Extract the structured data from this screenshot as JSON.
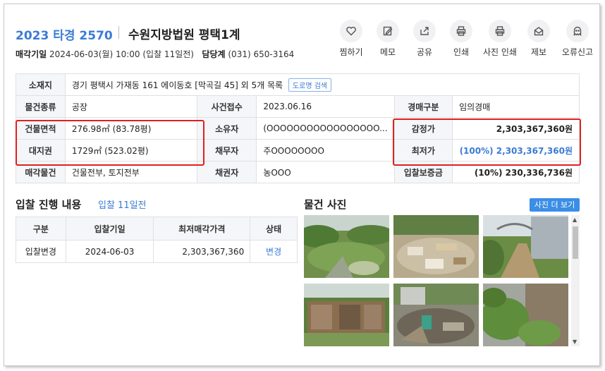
{
  "header": {
    "case_number": "2023 타경 2570",
    "court": "수원지방법원 평택1계",
    "sale_date_label": "매각기일",
    "sale_date_value": "2024-06-03(월) 10:00 (입찰 11일전)",
    "dept_label": "담당계",
    "dept_phone": "(031) 650-3164"
  },
  "actions": [
    {
      "label": "찜하기",
      "icon": "heart-icon"
    },
    {
      "label": "메모",
      "icon": "memo-icon"
    },
    {
      "label": "공유",
      "icon": "share-icon"
    },
    {
      "label": "인쇄",
      "icon": "print-icon"
    },
    {
      "label": "사진 인쇄",
      "icon": "print-icon"
    },
    {
      "label": "제보",
      "icon": "mail-icon"
    },
    {
      "label": "오류신고",
      "icon": "ghost-icon"
    }
  ],
  "details": {
    "location_label": "소재지",
    "location_value": "경기 평택시 가재동 161 에이동호 [막곡길 45] 외 5개 목록",
    "road_search": "도로명 검색",
    "type_label": "물건종류",
    "type_value": "공장",
    "received_label": "사건접수",
    "received_value": "2023.06.16",
    "auction_type_label": "경매구분",
    "auction_type_value": "임의경매",
    "building_area_label": "건물면적",
    "building_area_value": "276.98㎡ (83.78평)",
    "owner_label": "소유자",
    "owner_value": "(OOOOOOOOOOOOOOOOO...",
    "appraisal_label": "감정가",
    "appraisal_value": "2,303,367,360원",
    "land_label": "대지권",
    "land_value": "1729㎡ (523.02평)",
    "debtor_label": "채무자",
    "debtor_value": "주OOOOOOOO",
    "min_price_label": "최저가",
    "min_price_value": "(100%) 2,303,367,360원",
    "sale_item_label": "매각물건",
    "sale_item_value": "건물전부, 토지전부",
    "creditor_label": "채권자",
    "creditor_value": "농OOO",
    "deposit_label": "입찰보증금",
    "deposit_value": "(10%) 230,336,736원"
  },
  "bidding": {
    "title": "입찰 진행 내용",
    "subtitle": "입찰 11일전",
    "headers": [
      "구분",
      "입찰기일",
      "최저매각가격",
      "상태"
    ],
    "rows": [
      {
        "type": "입찰변경",
        "date": "2024-06-03",
        "price": "2,303,367,360",
        "status": "변경"
      }
    ]
  },
  "photos": {
    "title": "물건 사진",
    "more_button": "사진 더 보기",
    "count": 6
  },
  "colors": {
    "accent": "#3a7bd5",
    "highlight_border": "#e02020",
    "header_cell_bg": "#f4f6f9"
  }
}
